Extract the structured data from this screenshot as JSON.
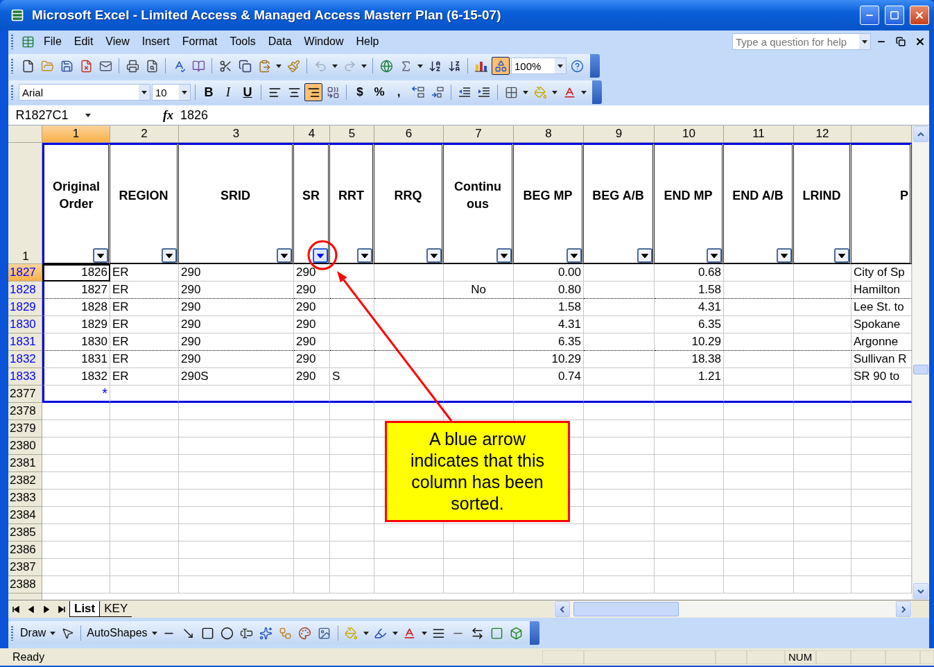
{
  "window": {
    "title": "Microsoft Excel - Limited Access & Managed Access Masterr Plan (6-15-07)"
  },
  "menu": {
    "items": [
      "File",
      "Edit",
      "View",
      "Insert",
      "Format",
      "Tools",
      "Data",
      "Window",
      "Help"
    ],
    "help_placeholder": "Type a question for help"
  },
  "standard_toolbar": {
    "drawing_selected": true,
    "zoom": "100%"
  },
  "formatting_toolbar": {
    "font": "Arial",
    "size": "10",
    "styles": [
      "B",
      "I",
      "U"
    ],
    "alignments": [
      {
        "kind": "left",
        "selected": false
      },
      {
        "kind": "center",
        "selected": false
      },
      {
        "kind": "right",
        "selected": true
      }
    ],
    "number_formats": [
      "$",
      "%",
      ","
    ]
  },
  "formula_bar": {
    "name_box": "R1827C1",
    "function_label": "fx",
    "value": "1826"
  },
  "sheet": {
    "column_numbers": [
      {
        "label": "1",
        "selected": true
      },
      {
        "label": "2",
        "selected": false
      },
      {
        "label": "3",
        "selected": false
      },
      {
        "label": "4",
        "selected": false
      },
      {
        "label": "5",
        "selected": false
      },
      {
        "label": "6",
        "selected": false
      },
      {
        "label": "7",
        "selected": false
      },
      {
        "label": "8",
        "selected": false
      },
      {
        "label": "9",
        "selected": false
      },
      {
        "label": "10",
        "selected": false
      },
      {
        "label": "11",
        "selected": false
      },
      {
        "label": "12",
        "selected": false
      }
    ],
    "header_row": {
      "number": "1",
      "cells": [
        {
          "label": "Original Order",
          "filter_button": true,
          "sorted": false
        },
        {
          "label": "REGION",
          "filter_button": true,
          "sorted": false
        },
        {
          "label": "SRID",
          "filter_button": true,
          "sorted": false
        },
        {
          "label": "SR",
          "filter_button": true,
          "sorted": true
        },
        {
          "label": "RRT",
          "filter_button": true,
          "sorted": false
        },
        {
          "label": "RRQ",
          "filter_button": true,
          "sorted": false
        },
        {
          "label": "Continuous",
          "filter_button": true,
          "sorted": false
        },
        {
          "label": "BEG MP",
          "filter_button": true,
          "sorted": false
        },
        {
          "label": "BEG A/B",
          "filter_button": true,
          "sorted": false
        },
        {
          "label": "END MP",
          "filter_button": true,
          "sorted": false
        },
        {
          "label": "END A/B",
          "filter_button": true,
          "sorted": false
        },
        {
          "label": "LRIND",
          "filter_button": true,
          "sorted": false
        },
        {
          "label": "P",
          "filter_button": false
        }
      ]
    },
    "rows": [
      {
        "number": "1827",
        "kind": "record",
        "selected": true,
        "page_break": false,
        "cells": {
          "1": "1826",
          "2": "ER",
          "3": "290",
          "4": "290",
          "8": "0.00",
          "10": "0.68",
          "13": "City of Sp"
        }
      },
      {
        "number": "1828",
        "kind": "record",
        "selected": false,
        "page_break": true,
        "cells": {
          "1": "1827",
          "2": "ER",
          "3": "290",
          "4": "290",
          "7": "No",
          "8": "0.80",
          "10": "1.58",
          "13": "Hamilton"
        }
      },
      {
        "number": "1829",
        "kind": "record",
        "selected": false,
        "page_break": false,
        "cells": {
          "1": "1828",
          "2": "ER",
          "3": "290",
          "4": "290",
          "8": "1.58",
          "10": "4.31",
          "13": "Lee St. to"
        }
      },
      {
        "number": "1830",
        "kind": "record",
        "selected": false,
        "page_break": false,
        "cells": {
          "1": "1829",
          "2": "ER",
          "3": "290",
          "4": "290",
          "8": "4.31",
          "10": "6.35",
          "13": "Spokane"
        }
      },
      {
        "number": "1831",
        "kind": "record",
        "selected": false,
        "page_break": true,
        "cells": {
          "1": "1830",
          "2": "ER",
          "3": "290",
          "4": "290",
          "8": "6.35",
          "10": "10.29",
          "13": "Argonne"
        }
      },
      {
        "number": "1832",
        "kind": "record",
        "selected": false,
        "page_break": false,
        "cells": {
          "1": "1831",
          "2": "ER",
          "3": "290",
          "4": "290",
          "8": "10.29",
          "10": "18.38",
          "13": "Sullivan R"
        }
      },
      {
        "number": "1833",
        "kind": "record",
        "selected": false,
        "page_break": false,
        "cells": {
          "1": "1832",
          "2": "ER",
          "3": "290S",
          "4": "290",
          "5": "S",
          "8": "0.74",
          "10": "1.21",
          "13": "SR 90 to"
        }
      },
      {
        "number": "2377",
        "kind": "new",
        "marker": "*"
      },
      {
        "number": "2378",
        "kind": "empty"
      },
      {
        "number": "2379",
        "kind": "empty"
      },
      {
        "number": "2380",
        "kind": "empty"
      },
      {
        "number": "2381",
        "kind": "empty"
      },
      {
        "number": "2382",
        "kind": "empty"
      },
      {
        "number": "2383",
        "kind": "empty"
      },
      {
        "number": "2384",
        "kind": "empty"
      },
      {
        "number": "2385",
        "kind": "empty"
      },
      {
        "number": "2386",
        "kind": "empty"
      },
      {
        "number": "2387",
        "kind": "empty"
      },
      {
        "number": "2388",
        "kind": "empty"
      }
    ]
  },
  "callout": {
    "text": "A blue arrow indicates that this column has been sorted."
  },
  "sheet_tabs": [
    {
      "label": "List",
      "selected": true
    },
    {
      "label": "KEY",
      "selected": false
    }
  ],
  "drawing_toolbar": {
    "draw": "Draw",
    "autoshapes": "AutoShapes"
  },
  "status_bar": {
    "status": "Ready",
    "indicators": [
      {
        "label": "NUM",
        "on": true
      }
    ]
  }
}
